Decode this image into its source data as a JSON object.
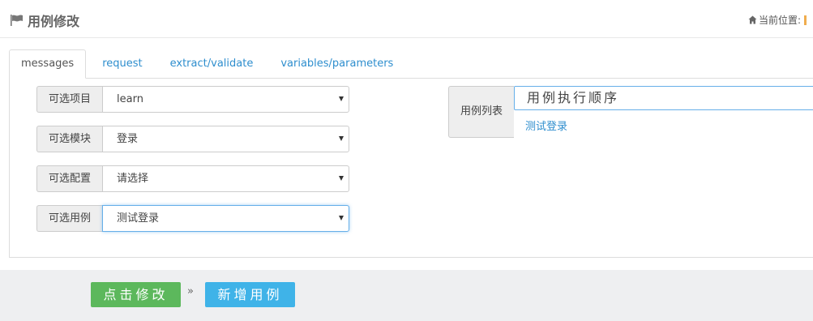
{
  "header": {
    "title": "用例修改",
    "breadcrumb_label": "当前位置:",
    "icons": {
      "title": "flag-icon",
      "breadcrumb": "home-icon"
    }
  },
  "tabs": [
    {
      "label": "messages",
      "active": true
    },
    {
      "label": "request",
      "active": false
    },
    {
      "label": "extract/validate",
      "active": false
    },
    {
      "label": "variables/parameters",
      "active": false
    }
  ],
  "form": {
    "project": {
      "label": "可选项目",
      "value": "learn"
    },
    "module": {
      "label": "可选模块",
      "value": "登录"
    },
    "config": {
      "label": "可选配置",
      "value": "请选择"
    },
    "case": {
      "label": "可选用例",
      "value": "测试登录"
    }
  },
  "case_list": {
    "label": "用例列表",
    "order_text": "用例执行顺序",
    "items": [
      "测试登录"
    ]
  },
  "footer": {
    "modify_button": "点击修改",
    "separator": "»",
    "add_button": "新增用例"
  },
  "colors": {
    "link": "#2e8ece",
    "modify_button": "#5cb85c",
    "add_button": "#3fb3e8",
    "footer_bg": "#eeeff1",
    "focus_border": "#66afe9"
  }
}
